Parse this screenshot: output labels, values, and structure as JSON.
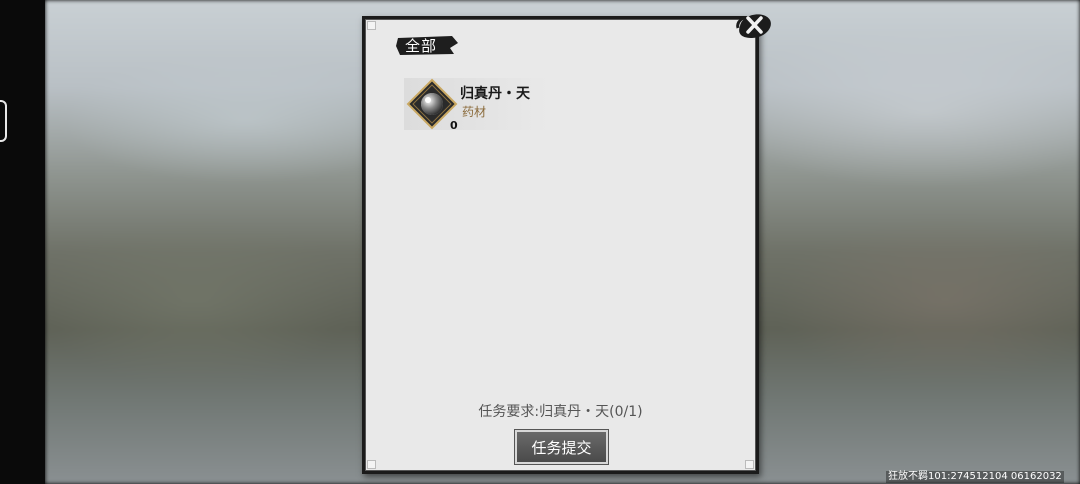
{
  "tabs": {
    "all_label": "全部"
  },
  "item": {
    "name": "归真丹・天",
    "type": "药材",
    "count": "0"
  },
  "requirement_text": "任务要求:归真丹・天(0/1)",
  "submit_label": "任务提交",
  "watermark": "狂放不羁101:274512104 06162032",
  "colors": {
    "panel_bg": "#e9e9e9",
    "item_type": "#8a6a3a",
    "button_bg": "#5a5a5a"
  },
  "icons": {
    "close": "close-icon",
    "item": "pill-icon"
  }
}
